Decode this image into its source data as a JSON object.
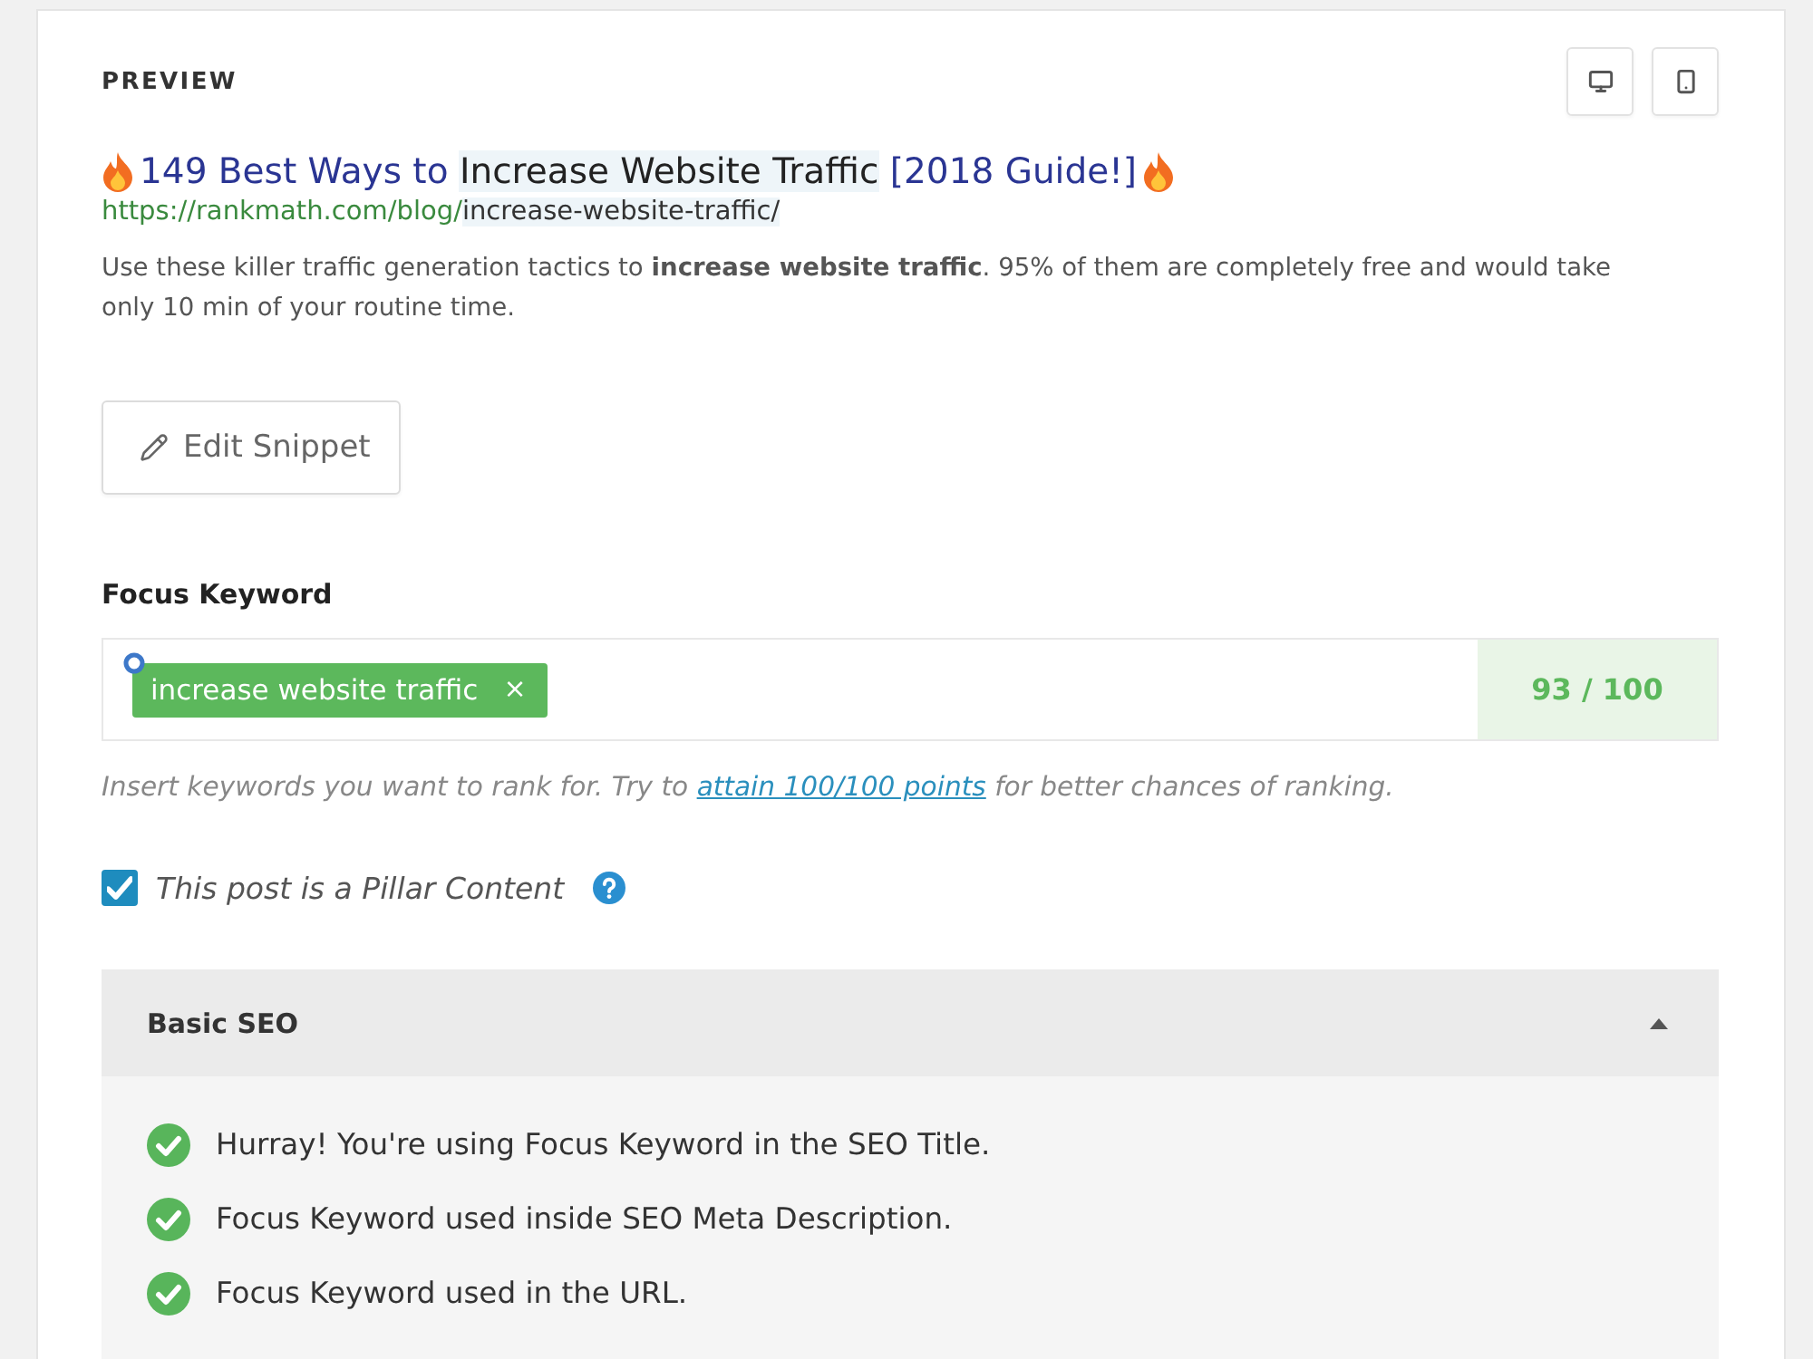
{
  "preview": {
    "heading": "PREVIEW"
  },
  "snippet": {
    "title": [
      {
        "text": "149 Best Ways to ",
        "highlight": false
      },
      {
        "text": "Increase Website Traffic",
        "highlight": true
      },
      {
        "text": " [2018 Guide!]",
        "highlight": false
      }
    ],
    "url": [
      {
        "text": "https://rankmath.com/blog/",
        "highlight": false
      },
      {
        "text": "increase-website-traffic/",
        "highlight": true
      }
    ],
    "description": "Use these killer traffic generation tactics to **increase website traffic**. 95% of them are completely free and would take only 10 min of your routine time."
  },
  "edit_button": "Edit Snippet",
  "focus_keyword": {
    "label": "Focus Keyword",
    "keywords": [
      {
        "text": "increase website traffic",
        "remove": "×"
      }
    ],
    "score": "93 / 100",
    "hint": {
      "before": "Insert keywords you want to rank for. Try to ",
      "link": "attain 100/100 points",
      "after": " for better chances of ranking."
    }
  },
  "pillar": {
    "label": "This post is a Pillar Content",
    "checked": true
  },
  "basic_seo": {
    "title": "Basic SEO",
    "expanded": true,
    "checks": [
      {
        "text": "Hurray! You're using Focus Keyword in the SEO Title.",
        "passed": true
      },
      {
        "text": "Focus Keyword used inside SEO Meta Description.",
        "passed": true
      },
      {
        "text": "Focus Keyword used in the URL.",
        "passed": true
      }
    ]
  }
}
